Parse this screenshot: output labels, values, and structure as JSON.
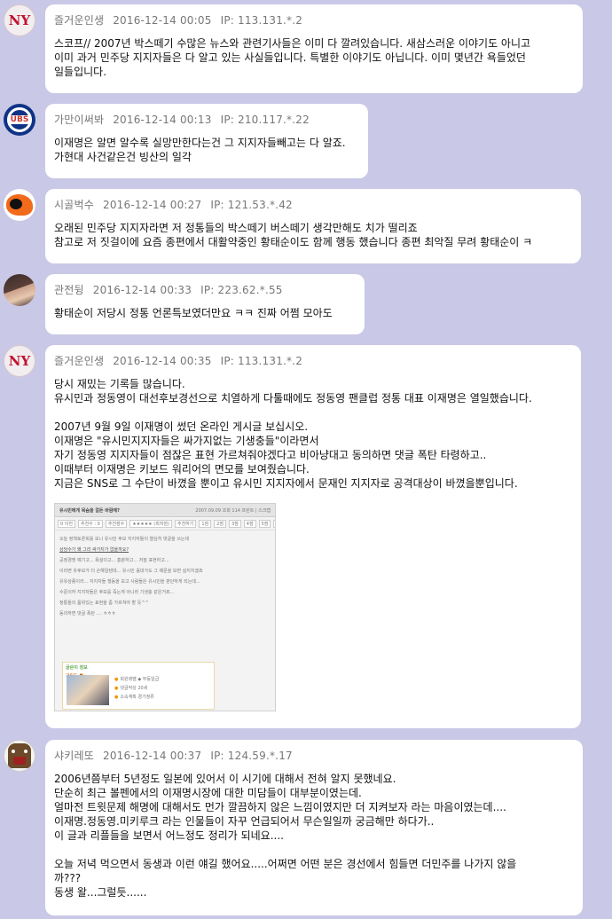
{
  "comments": [
    {
      "avatar": "yankees-logo",
      "author": "즐거운인생",
      "date": "2016-12-14 00:05",
      "ip": "IP: 113.131.*.2",
      "lines": [
        "스코프// 2007년 박스떼기 수많은 뉴스와 관련기사들은 이미 다 깔려있습니다. 새삼스러운 이야기도 아니고",
        "이미 과거 민주당 지지자들은 다 알고 있는 사실들입니다. 특별한 이야기도 아닙니다. 이미 몇년간 욕들었던",
        "일들입니다."
      ]
    },
    {
      "avatar": "cubs-logo",
      "author": "가만이써봐",
      "date": "2016-12-14 00:13",
      "ip": "IP: 210.117.*.22",
      "lines": [
        "이재명은 알면 알수록 실망만한다는건 그 지지자들빼고는 다 알죠.",
        "가현대 사건같은건 빙산의 일각"
      ]
    },
    {
      "avatar": "orioles-logo",
      "author": "시골벅수",
      "date": "2016-12-14 00:27",
      "ip": "IP: 121.53.*.42",
      "lines": [
        "오래된 민주당 지지자라면 저 정통들의 박스떼기 버스떼기 생각만해도 치가 떨리죠",
        "참고로 저 짓걸이에 요즘 종편에서 대활약중인 황태순이도 함께 행동 했습니다 종편 최악질 무려 황태순이 ㅋ"
      ]
    },
    {
      "avatar": "person-photo",
      "author": "관전뒹",
      "date": "2016-12-14 00:33",
      "ip": "IP: 223.62.*.55",
      "lines": [
        "황태순이 저당시 정통 언론특보였더만요 ㅋㅋ 진짜 어쩜 모아도"
      ]
    },
    {
      "avatar": "yankees-logo",
      "author": "즐거운인생",
      "date": "2016-12-14 00:35",
      "ip": "IP: 113.131.*.2",
      "lines": [
        "당시 재밌는 기록들 많습니다.",
        "유시민과 정동영이 대선후보경선으로 치열하게 다툴때에도 정동영 팬클럽 정통 대표 이재명은 열일했습니다.",
        "",
        "2007년 9월 9일 이재명이 썼던 온라인 게시글 보십시오.",
        "이재명은 \"유시민지지자들은 싸가지없는 기생충들\"이라면서",
        "자기 정동영 지지자들이 점잖은 표현 가르쳐줘야겠다고 비아냥대고 동의하면 댓글 폭탄 타령하고..",
        "이때부터 이재명은 키보드 워리어의 면모를 보여줬습니다.",
        "지금은 SNS로 그 수단이 바꼈을 뿐이고 유시민 지지자에서 문재인 지지자로 공격대상이 바꼈을뿐입니다."
      ],
      "embedded_screenshot": {
        "title": "유시민에게 목숨을 걸든 바람에?",
        "header_right": "2007.09.09 조회 114    프린트 | 스크랩",
        "toolbar": [
          "0 이전",
          "추천수 : 0",
          "추천점수",
          "★★★★★ (최저점)",
          "추천하기",
          "1점",
          "2점",
          "3점",
          "4점",
          "5점",
          "추천"
        ],
        "text_lines": [
          "오늘 정책토론회를 보니 유시민 후보 지지자들이 열심히 댓글을 쓰는데",
          "상당수가 왜 그리 싸가지가 없을까요?",
          "",
          "공정경쟁 얘기고... 욕설이고... 흥분하고... 저질 표현하고...",
          "",
          "이러면 유후보가 더 손해일텐데... 유시민 홀대가도 그 떼문을 보면 실지지겠죠",
          "",
          "유유상종이라... 지지자들 행동을 보고 사람들은 유시민을 판단하게 되는데...",
          "수준이하 지지자들은 후보를 죽는게 아니라 기생충 같은거죠...",
          "",
          "정통들의 품위있는 표현을 좀 가르쳐야 할 듯^^",
          "동의하면 댓글 폭탄 .... ㅎㅎㅎ"
        ],
        "card": {
          "title": "글쓴이 정보",
          "name": "가란도 ♥",
          "info": [
            "회원레벨  ◆ 무등일급",
            "댓글작성  20세",
            "소속계획  경기정류"
          ]
        }
      }
    },
    {
      "avatar": "domo-character",
      "author": "샤키레또",
      "date": "2016-12-14 00:37",
      "ip": "IP: 124.59.*.17",
      "lines": [
        "2006년쯤부터 5년정도 일본에 있어서 이 시기에 대해서 전혀 알지 못했네요.",
        "단순히 최근 볼펜에서의 이재명시장에 대한 미담들이 대부분이였는데.",
        "얼마전 트윗문제 해명에 대해서도 먼가 깔끔하지 않은 느낌이였지만 더 지켜보자 라는 마음이였는데....",
        "이재명.정동영.미키루크 라는 인물들이 자꾸 언급되어서 무슨일일까 궁금해만 하다가..",
        "이 글과 리플들을 보면서 어느정도 정리가 되네요....",
        "",
        "오늘 저녁 먹으면서 동생과 이런 얘길 했어요.....어쩌면 어떤 분은 경선에서 힘들면 더민주를 나가지 않을",
        "까???",
        "동생 왈...그럴듯......"
      ]
    }
  ]
}
